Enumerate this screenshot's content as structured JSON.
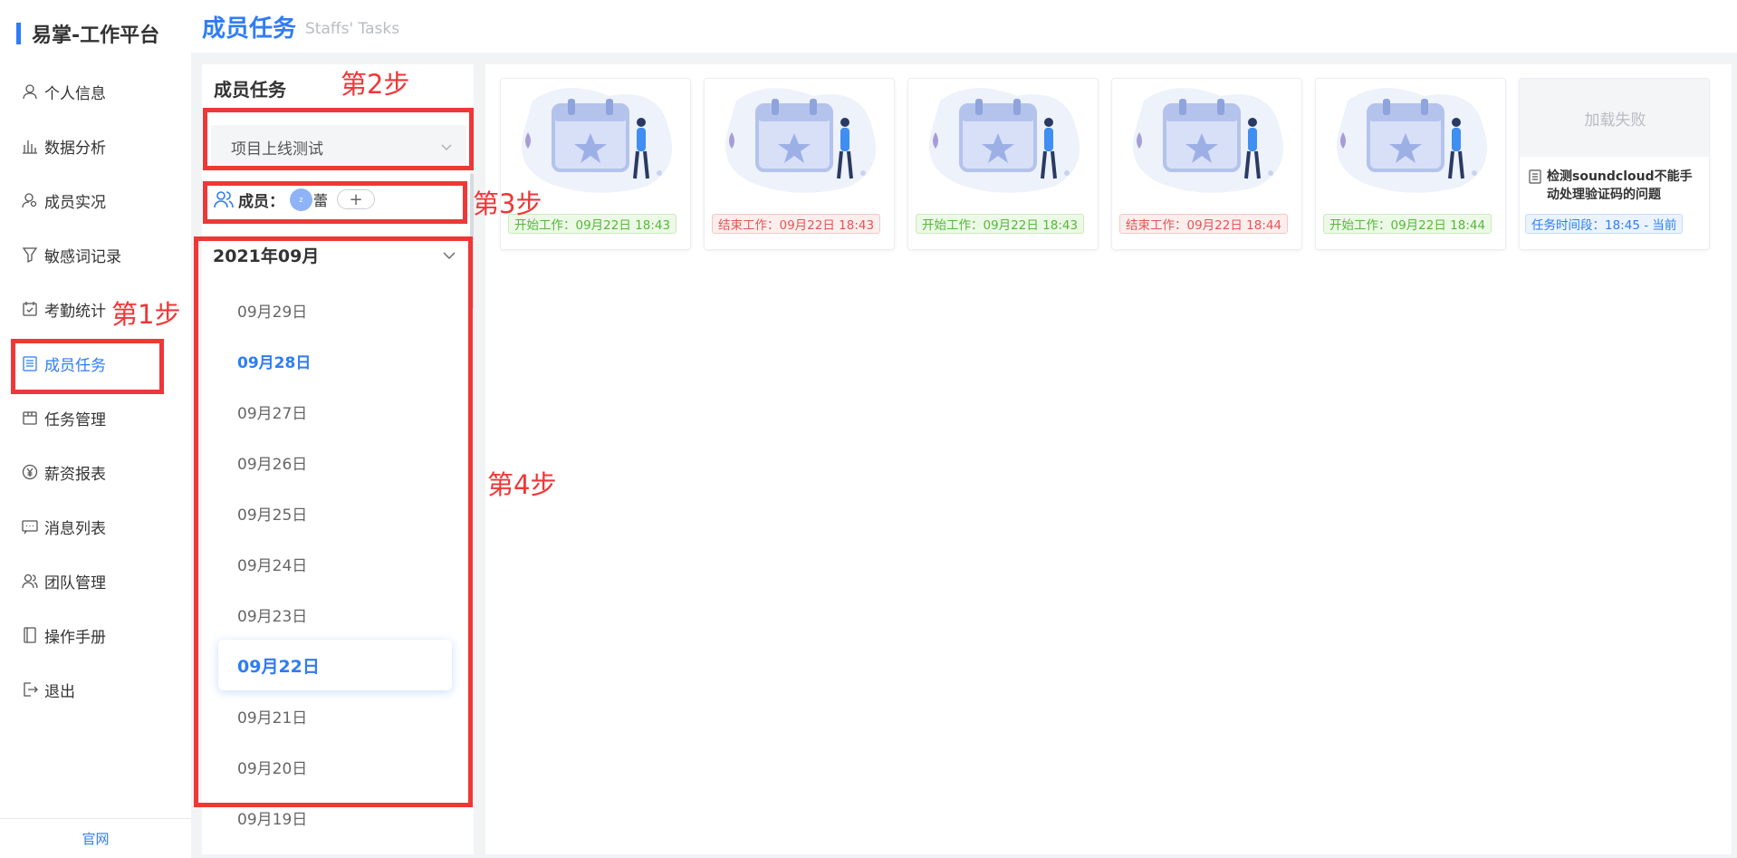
{
  "app": {
    "brand": "易掌-工作平台",
    "footer_link": "官网"
  },
  "sidebar": {
    "items": [
      {
        "label": "个人信息",
        "icon": "user-icon"
      },
      {
        "label": "数据分析",
        "icon": "bar-chart-icon"
      },
      {
        "label": "成员实况",
        "icon": "member-live-icon"
      },
      {
        "label": "敏感词记录",
        "icon": "filter-icon"
      },
      {
        "label": "考勤统计",
        "icon": "calendar-check-icon"
      },
      {
        "label": "成员任务",
        "icon": "task-list-icon",
        "active": true
      },
      {
        "label": "任务管理",
        "icon": "task-manage-icon"
      },
      {
        "label": "薪资报表",
        "icon": "yen-icon"
      },
      {
        "label": "消息列表",
        "icon": "message-icon"
      },
      {
        "label": "团队管理",
        "icon": "team-icon"
      },
      {
        "label": "操作手册",
        "icon": "manual-icon"
      },
      {
        "label": "退出",
        "icon": "logout-icon"
      }
    ]
  },
  "header": {
    "title": "成员任务",
    "subtitle": "Staffs' Tasks"
  },
  "panel": {
    "title": "成员任务",
    "project_select": "项目上线测试",
    "members_label": "成员：",
    "member_avatar_text": "z",
    "member_name": "蕾",
    "add_button": "+",
    "month": "2021年09月",
    "dates": [
      "09月29日",
      "09月28日",
      "09月27日",
      "09月26日",
      "09月25日",
      "09月24日",
      "09月23日",
      "09月22日",
      "09月21日",
      "09月20日",
      "09月19日"
    ],
    "highlighted_date": "09月28日",
    "selected_date": "09月22日"
  },
  "cards": [
    {
      "type": "start",
      "tag": "开始工作：09月22日 18:43"
    },
    {
      "type": "end",
      "tag": "结束工作：09月22日 18:43"
    },
    {
      "type": "start",
      "tag": "开始工作：09月22日 18:43"
    },
    {
      "type": "end",
      "tag": "结束工作：09月22日 18:44"
    },
    {
      "type": "start",
      "tag": "开始工作：09月22日 18:44"
    },
    {
      "type": "task",
      "load_fail": "加载失败",
      "task": "检测soundcloud不能手动处理验证码的问题",
      "tag": "任务时间段：18:45 - 当前"
    }
  ],
  "annotations": {
    "step1": "第1步",
    "step2": "第2步",
    "step3": "第3步",
    "step4": "第4步"
  },
  "colors": {
    "accent": "#2f7cf6",
    "annotation": "#ef3737",
    "start_tag": "#53b83a",
    "end_tag": "#e65454"
  }
}
